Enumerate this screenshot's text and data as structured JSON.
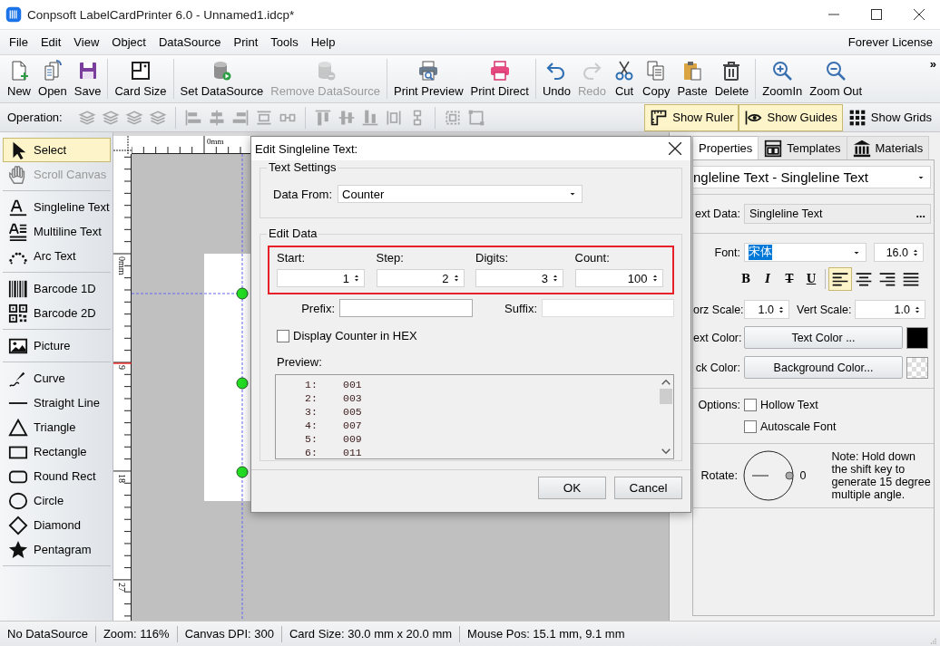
{
  "window": {
    "title": "Conpsoft LabelCardPrinter 6.0 - Unnamed1.idcp*"
  },
  "menu": {
    "items": [
      "File",
      "Edit",
      "View",
      "Object",
      "DataSource",
      "Print",
      "Tools",
      "Help"
    ],
    "license": "Forever License"
  },
  "toolbar": {
    "overflow": "»",
    "groups": [
      {
        "items": [
          {
            "label": "New",
            "disabled": false
          },
          {
            "label": "Open",
            "disabled": false
          },
          {
            "label": "Save",
            "disabled": false
          }
        ]
      },
      {
        "items": [
          {
            "label": "Card Size",
            "disabled": false
          }
        ]
      },
      {
        "items": [
          {
            "label": "Set DataSource",
            "disabled": false
          },
          {
            "label": "Remove DataSource",
            "disabled": true
          }
        ]
      },
      {
        "items": [
          {
            "label": "Print Preview",
            "disabled": false
          },
          {
            "label": "Print Direct",
            "disabled": false
          }
        ]
      },
      {
        "items": [
          {
            "label": "Undo",
            "disabled": false
          },
          {
            "label": "Redo",
            "disabled": true
          },
          {
            "label": "Cut",
            "disabled": false
          },
          {
            "label": "Copy",
            "disabled": false
          },
          {
            "label": "Paste",
            "disabled": false
          },
          {
            "label": "Delete",
            "disabled": false
          }
        ]
      },
      {
        "items": [
          {
            "label": "ZoomIn",
            "disabled": false
          },
          {
            "label": "Zoom Out",
            "disabled": false
          }
        ]
      }
    ]
  },
  "operation_bar": {
    "label": "Operation:",
    "groups": [
      {
        "items": [
          {
            "disabled": true
          },
          {
            "disabled": true
          },
          {
            "disabled": true
          },
          {
            "disabled": true
          }
        ]
      },
      {
        "items": [
          {
            "disabled": true
          },
          {
            "disabled": true
          },
          {
            "disabled": true
          },
          {
            "disabled": true
          },
          {
            "disabled": true
          }
        ]
      },
      {
        "items": [
          {
            "disabled": true
          },
          {
            "disabled": true
          },
          {
            "disabled": true
          },
          {
            "disabled": true
          },
          {
            "disabled": true
          }
        ]
      },
      {
        "items": [
          {
            "disabled": true
          },
          {
            "disabled": true
          }
        ]
      }
    ],
    "toggles": [
      {
        "label": "Show Ruler",
        "selected": true
      },
      {
        "label": "Show Guides",
        "selected": true
      },
      {
        "label": "Show Grids",
        "selected": false
      }
    ]
  },
  "toolbox": {
    "groups": [
      {
        "items": [
          {
            "label": "Select",
            "selected": true,
            "disabled": false
          },
          {
            "label": "Scroll Canvas",
            "selected": false,
            "disabled": true
          }
        ]
      },
      {
        "items": [
          {
            "label": "Singleline Text",
            "selected": false,
            "disabled": false
          },
          {
            "label": "Multiline Text",
            "selected": false,
            "disabled": false
          },
          {
            "label": "Arc Text",
            "selected": false,
            "disabled": false
          }
        ]
      },
      {
        "items": [
          {
            "label": "Barcode 1D",
            "selected": false,
            "disabled": false
          },
          {
            "label": "Barcode 2D",
            "selected": false,
            "disabled": false
          }
        ]
      },
      {
        "items": [
          {
            "label": "Picture",
            "selected": false,
            "disabled": false
          }
        ]
      },
      {
        "items": [
          {
            "label": "Curve",
            "selected": false,
            "disabled": false
          },
          {
            "label": "Straight Line",
            "selected": false,
            "disabled": false
          },
          {
            "label": "Triangle",
            "selected": false,
            "disabled": false
          },
          {
            "label": "Rectangle",
            "selected": false,
            "disabled": false
          },
          {
            "label": "Round Rect",
            "selected": false,
            "disabled": false
          },
          {
            "label": "Circle",
            "selected": false,
            "disabled": false
          },
          {
            "label": "Diamond",
            "selected": false,
            "disabled": false
          },
          {
            "label": "Pentagram",
            "selected": false,
            "disabled": false
          }
        ]
      }
    ]
  },
  "canvas": {
    "top_ruler_label": "0mm",
    "left_ruler_labels": [
      "0mm",
      "9",
      "18",
      "27"
    ]
  },
  "dialog": {
    "title": "Edit Singleline Text:",
    "text_settings": {
      "title": "Text Settings",
      "data_from_label": "Data From:",
      "data_from": "Counter"
    },
    "edit_data": {
      "title": "Edit Data",
      "counter_highlighted": true,
      "counter_fields": [
        {
          "label": "Start:",
          "value": "1"
        },
        {
          "label": "Step:",
          "value": "2"
        },
        {
          "label": "Digits:",
          "value": "3"
        },
        {
          "label": "Count:",
          "value": "100"
        }
      ],
      "prefix_label": "Prefix:",
      "suffix_label": "Suffix:",
      "hex": {
        "label": "Display Counter in HEX",
        "checked": false
      },
      "preview_label": "Preview:",
      "preview_rows": [
        {
          "index": "1:",
          "value": "001"
        },
        {
          "index": "2:",
          "value": "003"
        },
        {
          "index": "3:",
          "value": "005"
        },
        {
          "index": "4:",
          "value": "007"
        },
        {
          "index": "5:",
          "value": "009"
        },
        {
          "index": "6:",
          "value": "011"
        }
      ]
    },
    "buttons": [
      "OK",
      "Cancel"
    ]
  },
  "properties_panel": {
    "tabs": [
      {
        "label": "Properties",
        "selected": true
      },
      {
        "label": "Templates",
        "selected": false
      },
      {
        "label": "Materials",
        "selected": false
      }
    ],
    "object": "ngleline Text - Singleline Text",
    "text_data_label": "ext Data:",
    "text_data": "Singleline Text",
    "text_data_button": "...",
    "font_label": "Font:",
    "font": {
      "value": "宋体",
      "selected": true
    },
    "font_size": "16.0",
    "style_buttons": [
      {
        "label": "B",
        "selected": false
      },
      {
        "label": "I",
        "selected": false
      },
      {
        "label": "T",
        "selected": false
      },
      {
        "label": "U",
        "selected": false
      }
    ],
    "align_buttons": [
      {
        "selected": true
      },
      {
        "selected": false
      },
      {
        "selected": false
      },
      {
        "selected": false
      }
    ],
    "horz_scale_label": "orz Scale:",
    "horz_scale": "1.0",
    "vert_scale_label": "Vert Scale:",
    "vert_scale": "1.0",
    "text_color_label": "ext Color:",
    "text_color_button": "Text Color ...",
    "back_color_label": "ck Color:",
    "back_color_button": "Background Color...",
    "options_label": "Options:",
    "options": [
      {
        "label": "Hollow Text",
        "checked": false
      },
      {
        "label": "Autoscale Font",
        "checked": false
      }
    ],
    "rotate_label": "Rotate:",
    "rotate_value": "0",
    "note": "Note: Hold down the shift key to generate 15 degree multiple angle."
  },
  "status_bar": [
    "No DataSource",
    "Zoom: 116%",
    "Canvas DPI: 300",
    "Card Size: 30.0 mm x 20.0 mm",
    "Mouse Pos: 15.1 mm, 9.1 mm"
  ]
}
